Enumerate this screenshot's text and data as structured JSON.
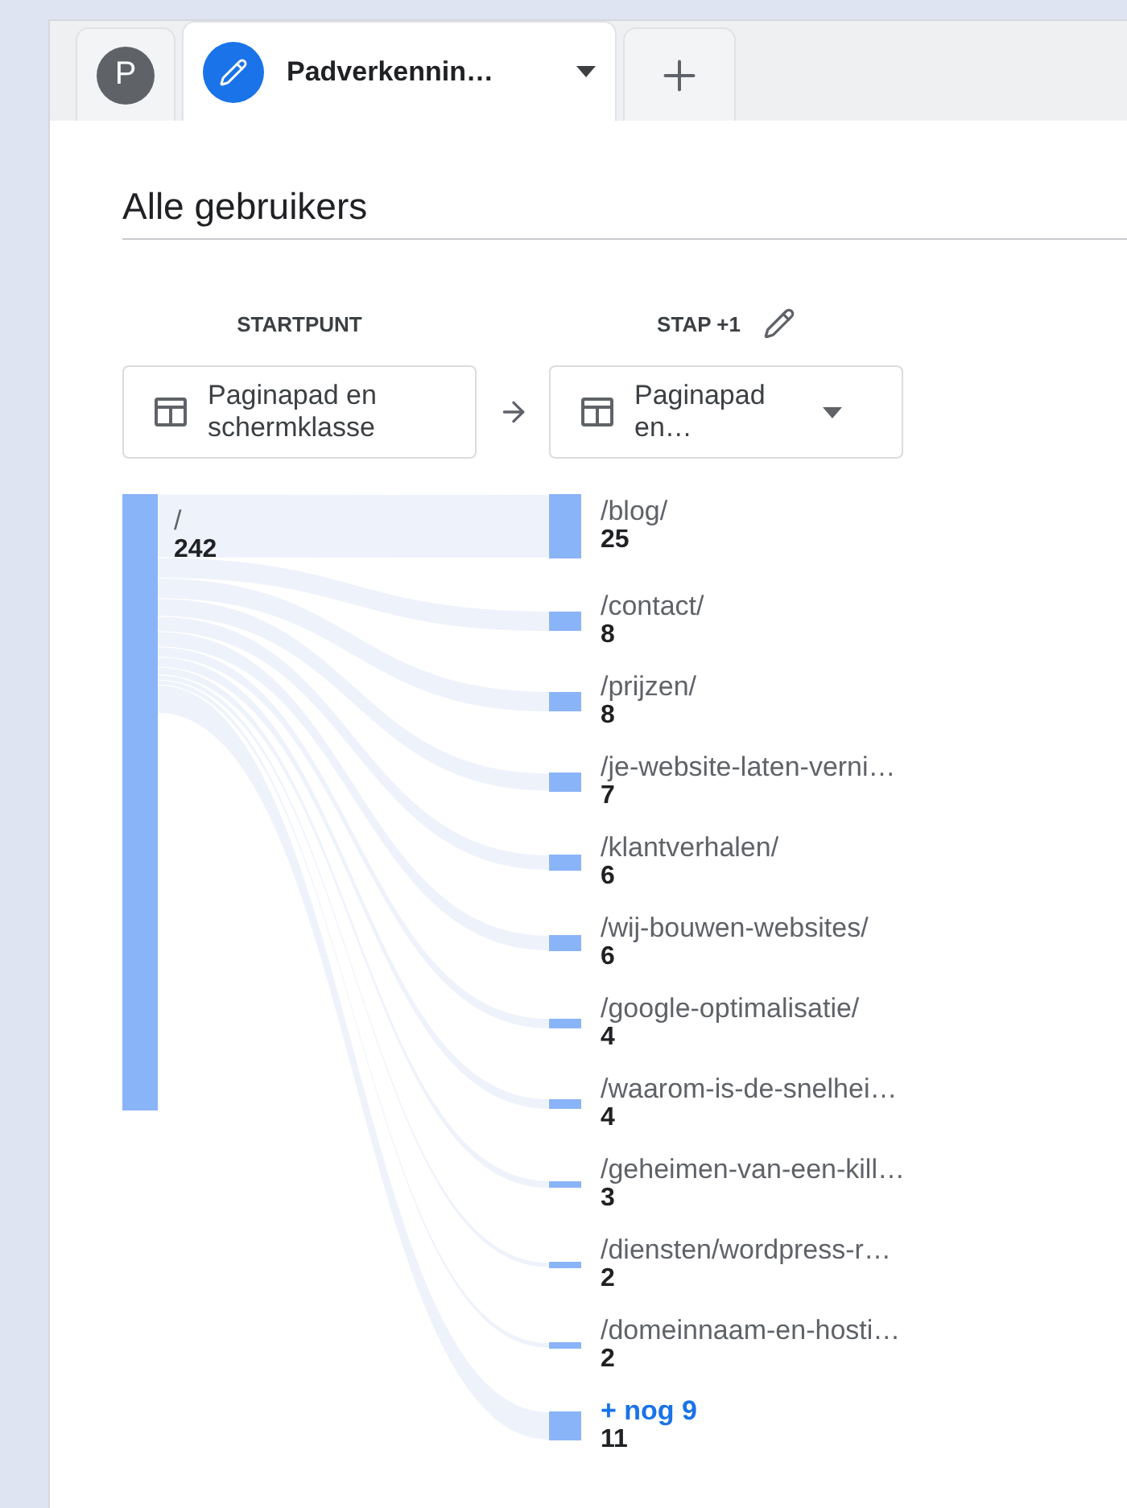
{
  "tabs": [
    {
      "kind": "avatar",
      "label": "P",
      "selected": false
    },
    {
      "kind": "exploration",
      "label": "Padverkennin…",
      "selected": true
    },
    {
      "kind": "add",
      "selected": false
    }
  ],
  "segment": "Alle gebruikers",
  "steps": [
    {
      "heading": "STARTPUNT",
      "dimension": "Paginapad en schermklasse",
      "editable": false,
      "dropdown": false
    },
    {
      "heading": "STAP +1",
      "dimension": "Paginapad en…",
      "editable": true,
      "dropdown": true
    }
  ],
  "start": {
    "label": "/",
    "value": "242"
  },
  "targets": [
    {
      "kind": "page",
      "label": "/blog/",
      "value": "25"
    },
    {
      "kind": "page",
      "label": "/contact/",
      "value": "8"
    },
    {
      "kind": "page",
      "label": "/prijzen/",
      "value": "8"
    },
    {
      "kind": "page",
      "label": "/je-website-laten-verni…",
      "value": "7"
    },
    {
      "kind": "page",
      "label": "/klantverhalen/",
      "value": "6"
    },
    {
      "kind": "page",
      "label": "/wij-bouwen-websites/",
      "value": "6"
    },
    {
      "kind": "page",
      "label": "/google-optimalisatie/",
      "value": "4"
    },
    {
      "kind": "page",
      "label": "/waarom-is-de-snelhei…",
      "value": "4"
    },
    {
      "kind": "page",
      "label": "/geheimen-van-een-kill…",
      "value": "3"
    },
    {
      "kind": "page",
      "label": "/diensten/wordpress-r…",
      "value": "2"
    },
    {
      "kind": "page",
      "label": "/domeinnaam-en-hosti…",
      "value": "2"
    },
    {
      "kind": "more",
      "label": "+ nog 9",
      "value": "11"
    }
  ]
}
